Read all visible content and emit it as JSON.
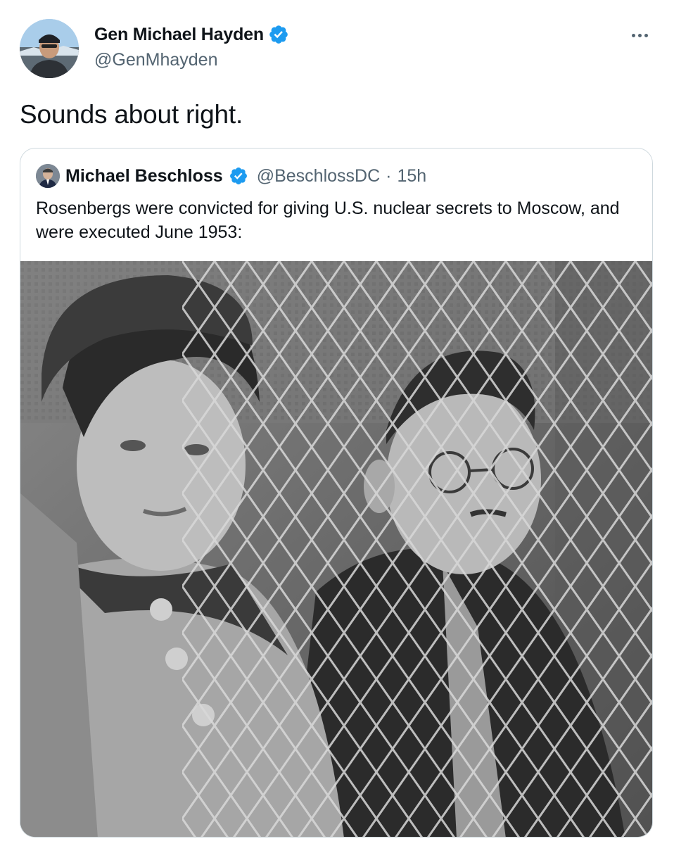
{
  "author": {
    "display_name": "Gen Michael Hayden",
    "handle": "@GenMhayden",
    "verified": true,
    "avatar_icon": "profile-photo-icon"
  },
  "tweet": {
    "text": "Sounds about right."
  },
  "more_menu": {
    "icon": "more-options-icon"
  },
  "quoted_tweet": {
    "display_name": "Michael Beschloss",
    "handle": "@BeschlossDC",
    "separator": "·",
    "time": "15h",
    "verified": true,
    "text": "Rosenbergs were convicted for giving U.S. nuclear secrets to Moscow, and were executed June 1953:",
    "media": {
      "type": "photo",
      "style": "black-and-white",
      "subject": "two people behind wire mesh"
    }
  },
  "colors": {
    "verified_blue": "#1d9bf0",
    "text_primary": "#0f1419",
    "text_secondary": "#536471",
    "border": "#cfd9de"
  }
}
